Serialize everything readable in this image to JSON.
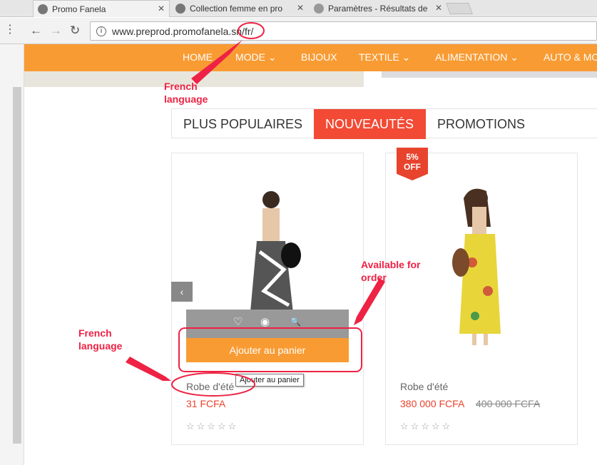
{
  "browser": {
    "tabs": [
      {
        "title": "Promo Fanela",
        "close": "✕"
      },
      {
        "title": "Collection femme en pro",
        "close": "✕"
      },
      {
        "title": "Paramètres - Résultats de",
        "close": "✕"
      }
    ],
    "url": "www.preprod.promofanela.sn/fr/"
  },
  "menu": {
    "items": [
      "HOME",
      "MODE ⌄",
      "BIJOUX",
      "TEXTILE ⌄",
      "ALIMENTATION ⌄",
      "AUTO & MO"
    ]
  },
  "product_tabs": [
    "PLUS POPULAIRES",
    "NOUVEAUTÉS",
    "PROMOTIONS"
  ],
  "products": [
    {
      "name": "Robe d'été",
      "price": "31 FCFA",
      "old_price": "",
      "stars": "☆☆☆☆☆"
    },
    {
      "name": "Robe d'été",
      "price": "380 000 FCFA",
      "old_price": "400 000 FCFA",
      "stars": "☆☆☆☆☆"
    }
  ],
  "badge": {
    "line1": "5%",
    "line2": "OFF"
  },
  "actions": {
    "add_to_cart": "Ajouter au panier",
    "tooltip": "Ajouter au panier",
    "prev": "‹",
    "wishlist_icon": "♡",
    "compare_icon": "◉",
    "quickview_icon": "🔍"
  },
  "annotations": {
    "url_note_1": "French",
    "url_note_2": "language",
    "name_note_1": "French",
    "name_note_2": "language",
    "avail_note_1": "Available for",
    "avail_note_2": "order"
  },
  "colors": {
    "accent": "#f99b33",
    "active_tab": "#f24a35",
    "annotation": "#ee2244"
  }
}
